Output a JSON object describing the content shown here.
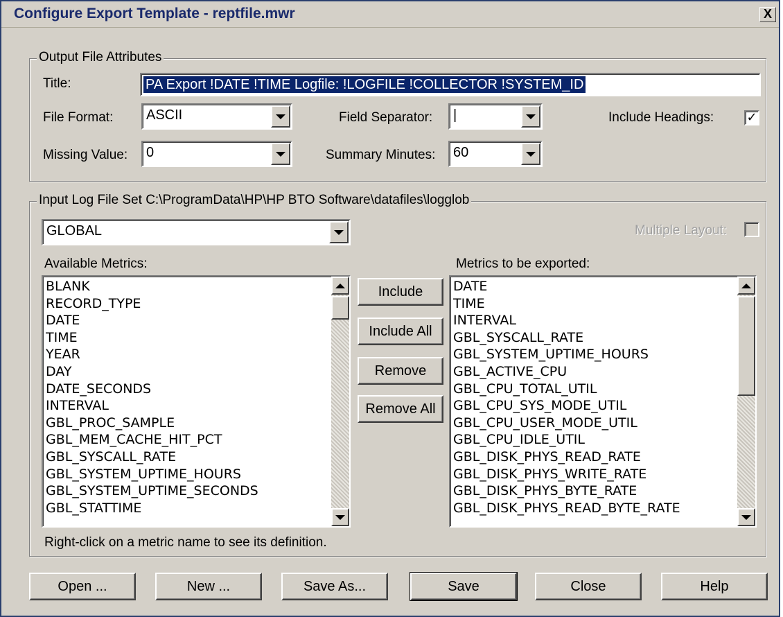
{
  "window": {
    "title": "Configure Export Template - reptfile.mwr",
    "close_label": "X"
  },
  "output_group": {
    "label": "Output File Attributes",
    "title_label": "Title:",
    "title_value": "PA Export !DATE !TIME Logfile: !LOGFILE !COLLECTOR !SYSTEM_ID",
    "file_format_label": "File Format:",
    "file_format_value": "ASCII",
    "field_separator_label": "Field Separator:",
    "field_separator_value": "|",
    "include_headings_label": "Include Headings:",
    "include_headings_checked": "✓",
    "missing_value_label": "Missing Value:",
    "missing_value_value": "0",
    "summary_minutes_label": "Summary Minutes:",
    "summary_minutes_value": "60"
  },
  "input_group": {
    "label": "Input Log File Set C:\\ProgramData\\HP\\HP BTO Software\\datafiles\\logglob",
    "class_value": "GLOBAL",
    "multiple_layout_label": "Multiple Layout:",
    "available_label": "Available Metrics:",
    "exported_label": "Metrics to be exported:",
    "available_metrics": [
      "BLANK",
      "RECORD_TYPE",
      "DATE",
      "TIME",
      "YEAR",
      "DAY",
      "DATE_SECONDS",
      "INTERVAL",
      "GBL_PROC_SAMPLE",
      "GBL_MEM_CACHE_HIT_PCT",
      "GBL_SYSCALL_RATE",
      "GBL_SYSTEM_UPTIME_HOURS",
      "GBL_SYSTEM_UPTIME_SECONDS",
      "GBL_STATTIME"
    ],
    "exported_metrics": [
      "DATE",
      "TIME",
      "INTERVAL",
      "GBL_SYSCALL_RATE",
      "GBL_SYSTEM_UPTIME_HOURS",
      "GBL_ACTIVE_CPU",
      "GBL_CPU_TOTAL_UTIL",
      "GBL_CPU_SYS_MODE_UTIL",
      "GBL_CPU_USER_MODE_UTIL",
      "GBL_CPU_IDLE_UTIL",
      "GBL_DISK_PHYS_READ_RATE",
      "GBL_DISK_PHYS_WRITE_RATE",
      "GBL_DISK_PHYS_BYTE_RATE",
      "GBL_DISK_PHYS_READ_BYTE_RATE"
    ],
    "include_label": "Include",
    "include_all_label": "Include All",
    "remove_label": "Remove",
    "remove_all_label": "Remove All",
    "hint": "Right-click on a metric name to see its definition."
  },
  "footer": {
    "open_label": "Open ...",
    "new_label": "New ...",
    "save_as_label": "Save As...",
    "save_label": "Save",
    "close_label": "Close",
    "help_label": "Help"
  }
}
